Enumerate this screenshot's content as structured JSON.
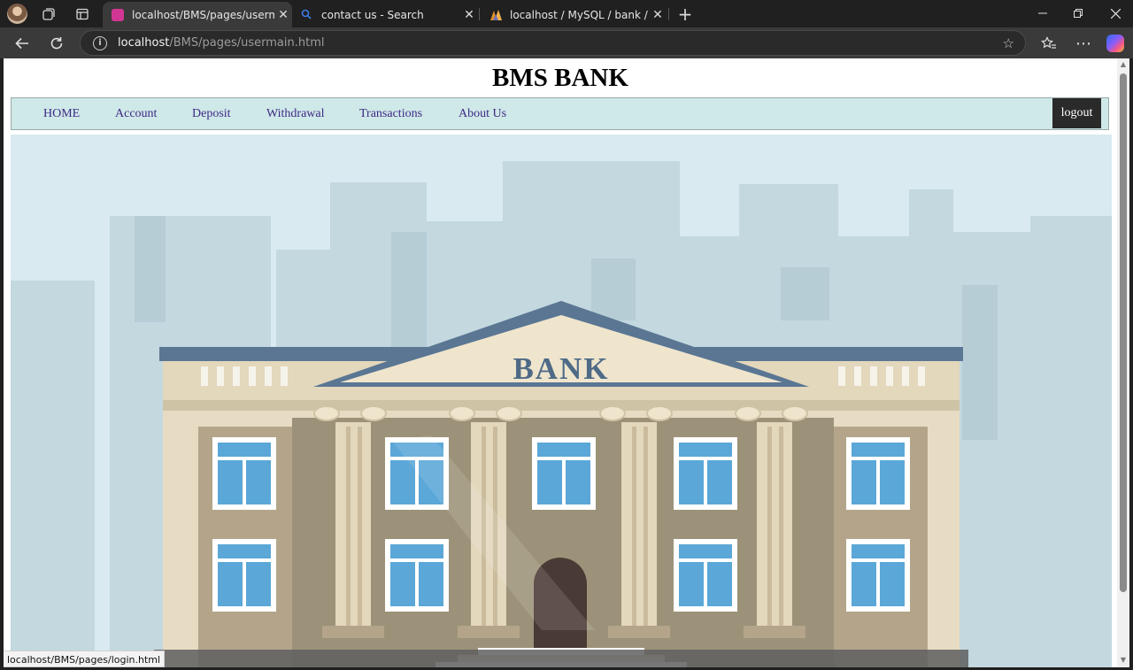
{
  "browser": {
    "tabs": [
      {
        "title": "localhost/BMS/pages/usermain.ht",
        "active": true,
        "favicon_color": "#d23694"
      },
      {
        "title": "contact us - Search",
        "active": false,
        "favicon_color": "#3b7be4"
      },
      {
        "title": "localhost / MySQL / bank / querie",
        "active": false,
        "favicon_color": "#e0902a"
      }
    ],
    "address": {
      "host": "localhost",
      "path": "/BMS/pages/usermain.html"
    },
    "status_url": "localhost/BMS/pages/login.html"
  },
  "site": {
    "title": "BMS BANK",
    "nav": {
      "home": "HOME",
      "account": "Account",
      "deposit": "Deposit",
      "withdrawal": "Withdrawal",
      "transactions": "Transactions",
      "about": "About Us",
      "logout": "logout"
    },
    "hero": {
      "building_sign": "BANK"
    }
  },
  "colors": {
    "navbar_bg": "#cfe8e8",
    "nav_link": "#3d2a85",
    "logout_bg": "#2a2a2a"
  }
}
